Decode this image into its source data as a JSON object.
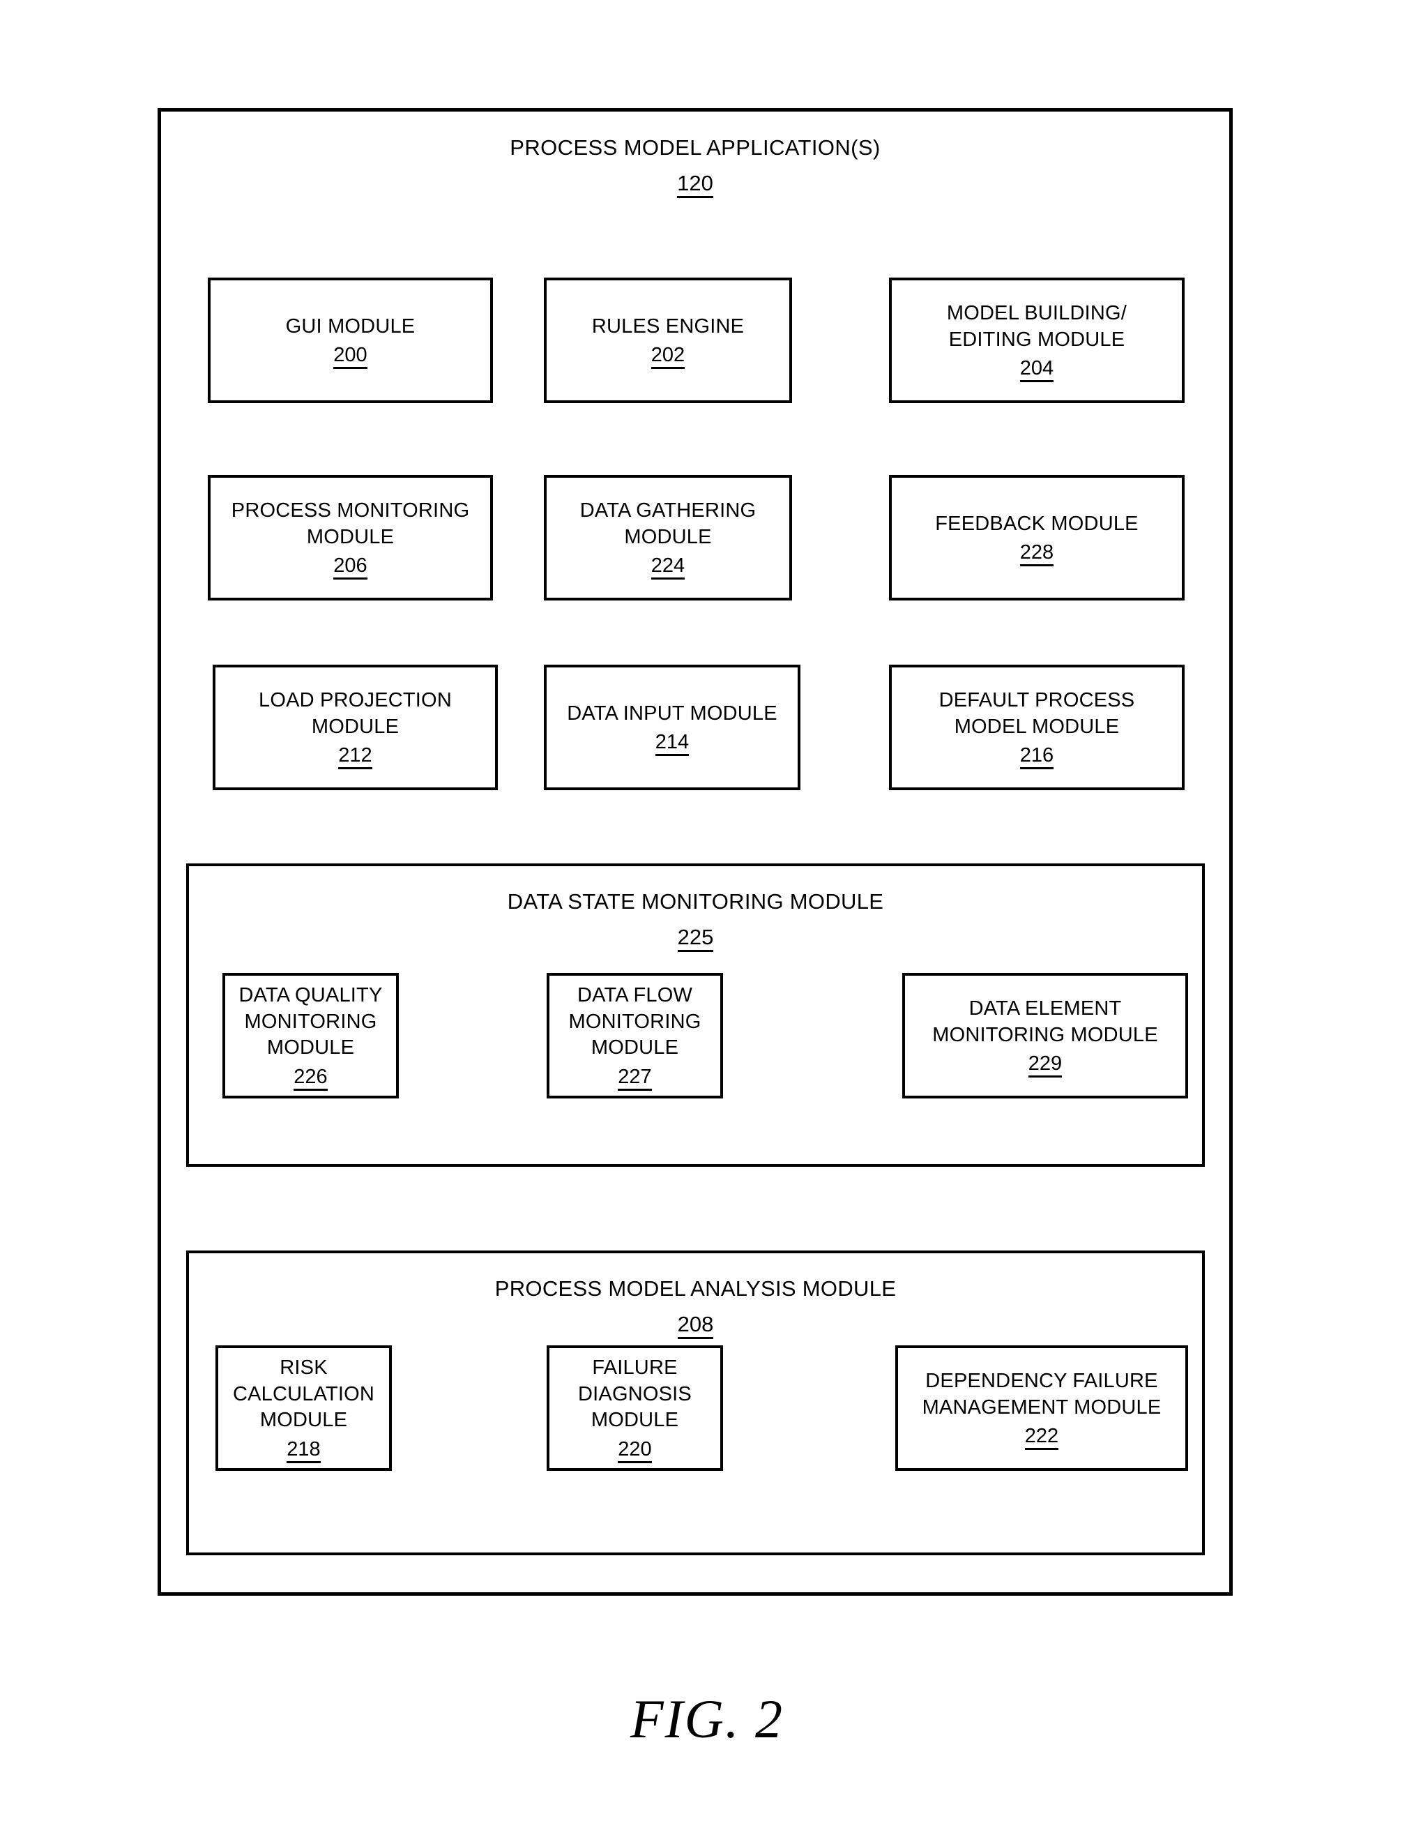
{
  "figure": {
    "caption": "FIG. 2"
  },
  "root": {
    "title": "PROCESS MODEL APPLICATION(S)",
    "ref": "120"
  },
  "modules": [
    {
      "label": "GUI MODULE",
      "ref": "200"
    },
    {
      "label": "RULES ENGINE",
      "ref": "202"
    },
    {
      "label": "MODEL BUILDING/\nEDITING MODULE",
      "ref": "204"
    },
    {
      "label": "PROCESS MONITORING\nMODULE",
      "ref": "206"
    },
    {
      "label": "DATA GATHERING\nMODULE",
      "ref": "224"
    },
    {
      "label": "FEEDBACK MODULE",
      "ref": "228"
    },
    {
      "label": "LOAD PROJECTION\nMODULE",
      "ref": "212"
    },
    {
      "label": "DATA INPUT MODULE",
      "ref": "214"
    },
    {
      "label": "DEFAULT PROCESS\nMODEL MODULE",
      "ref": "216"
    }
  ],
  "data_state_group": {
    "title": "DATA STATE MONITORING MODULE",
    "ref": "225",
    "modules": [
      {
        "label": "DATA QUALITY\nMONITORING MODULE",
        "ref": "226"
      },
      {
        "label": "DATA FLOW\nMONITORING MODULE",
        "ref": "227"
      },
      {
        "label": "DATA ELEMENT\nMONITORING MODULE",
        "ref": "229"
      }
    ]
  },
  "analysis_group": {
    "title": "PROCESS MODEL ANALYSIS MODULE",
    "ref": "208",
    "modules": [
      {
        "label": "RISK CALCULATION\nMODULE",
        "ref": "218"
      },
      {
        "label": "FAILURE DIAGNOSIS\nMODULE",
        "ref": "220"
      },
      {
        "label": "DEPENDENCY FAILURE\nMANAGEMENT MODULE",
        "ref": "222"
      }
    ]
  }
}
